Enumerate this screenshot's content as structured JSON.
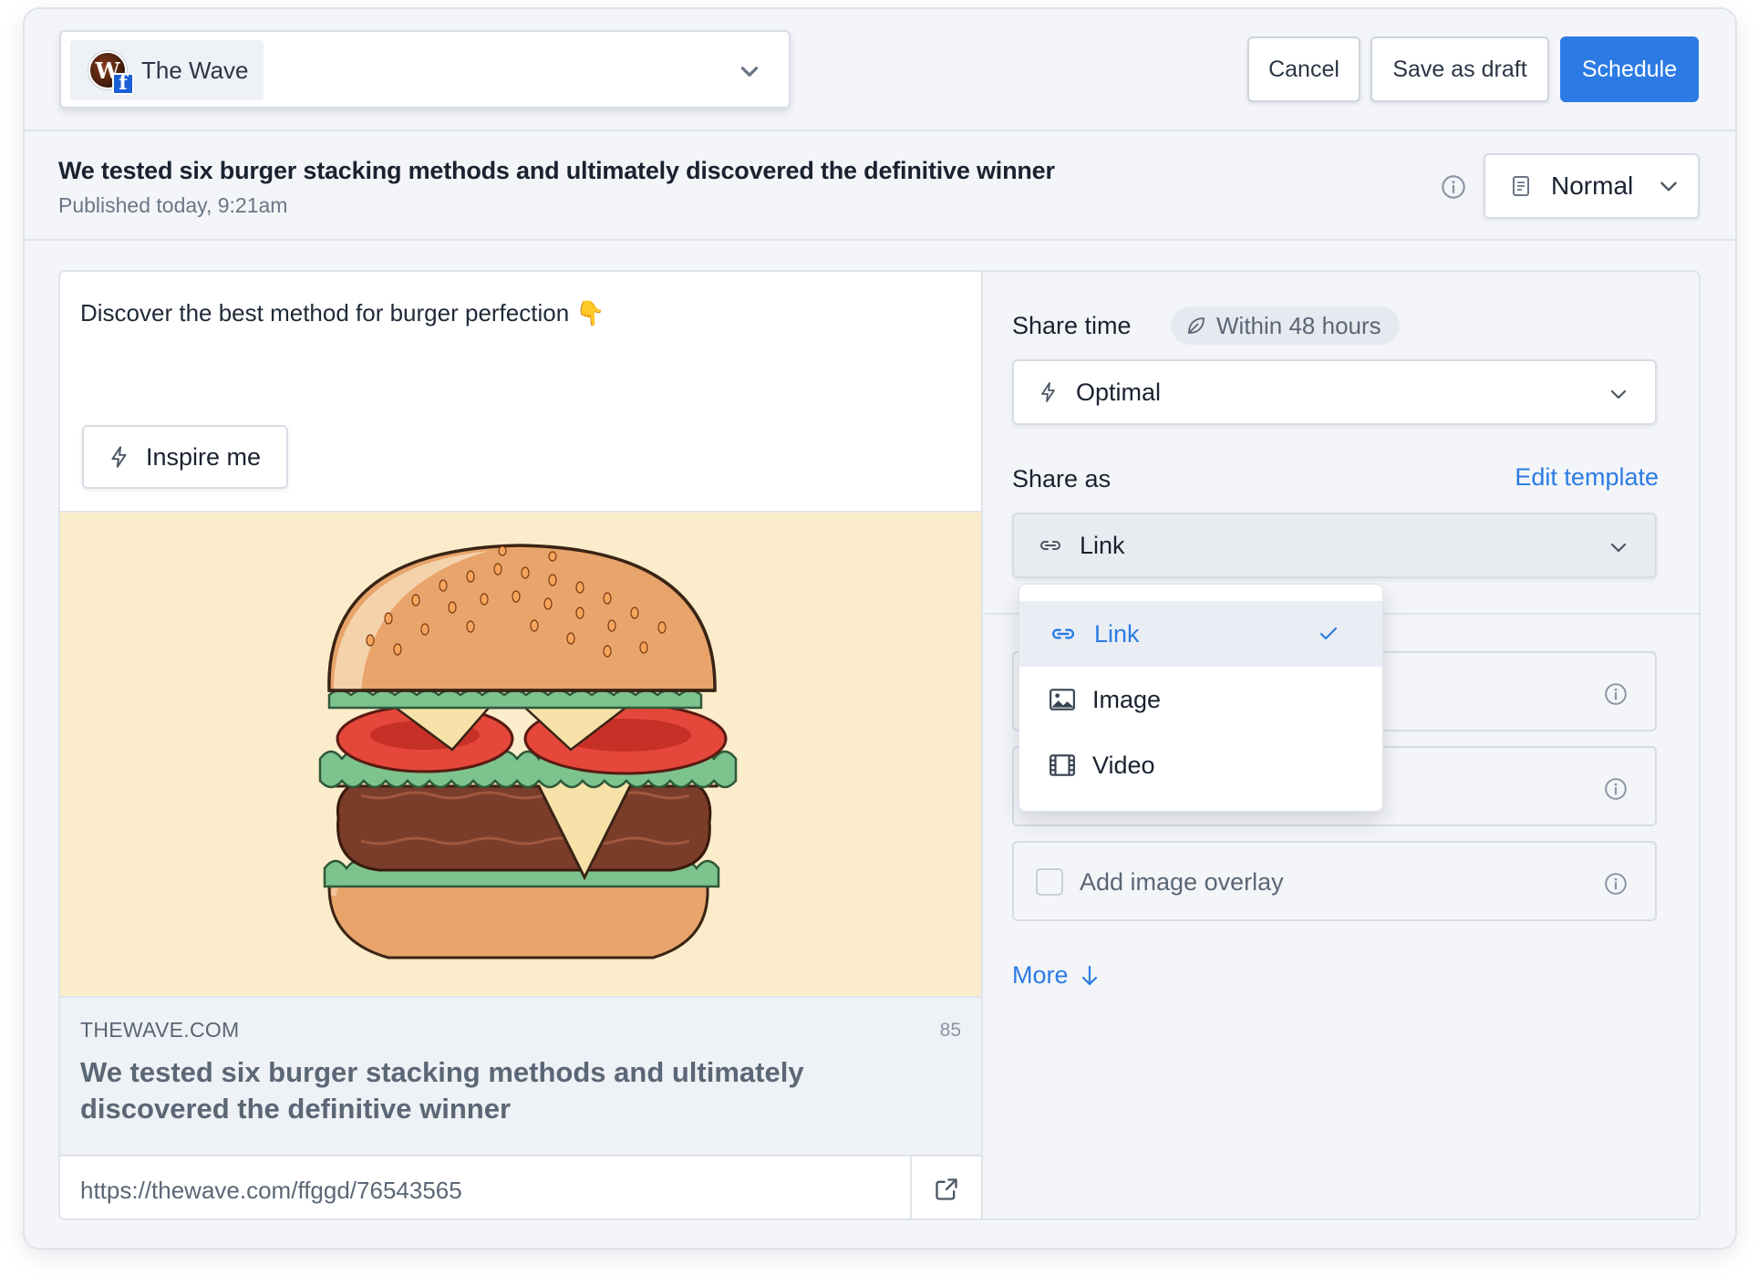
{
  "header": {
    "page": {
      "name": "The Wave",
      "avatar_letter": "W",
      "network_badge": "f"
    },
    "buttons": {
      "cancel": "Cancel",
      "save_draft": "Save as draft",
      "schedule": "Schedule"
    }
  },
  "post": {
    "title": "We tested six burger stacking methods and ultimately discovered the definitive winner",
    "published": "Published today, 9:21am",
    "mode": "Normal"
  },
  "editor": {
    "text": "Discover the best method for burger perfection 👇",
    "inspire_label": "Inspire me",
    "image_subject": "burger illustration",
    "link_preview": {
      "domain": "THEWAVE.COM",
      "char_count": "85",
      "title": "We tested six burger stacking methods and ultimately discovered the definitive winner"
    },
    "url": "https://thewave.com/ffggd/76543565"
  },
  "settings": {
    "share_time_label": "Share time",
    "time_badge": "Within 48 hours",
    "share_time_value": "Optimal",
    "share_as_label": "Share as",
    "edit_template": "Edit template",
    "share_as_value": "Link",
    "overlay_label": "Add image overlay",
    "more_label": "More"
  },
  "dropdown": {
    "options": [
      {
        "label": "Link",
        "icon": "link-icon",
        "selected": true
      },
      {
        "label": "Image",
        "icon": "image-icon",
        "selected": false
      },
      {
        "label": "Video",
        "icon": "film-icon",
        "selected": false
      }
    ]
  },
  "colors": {
    "accent": "#2c7be5",
    "background": "#f3f5f8",
    "image_bg": "#fbeccb"
  }
}
